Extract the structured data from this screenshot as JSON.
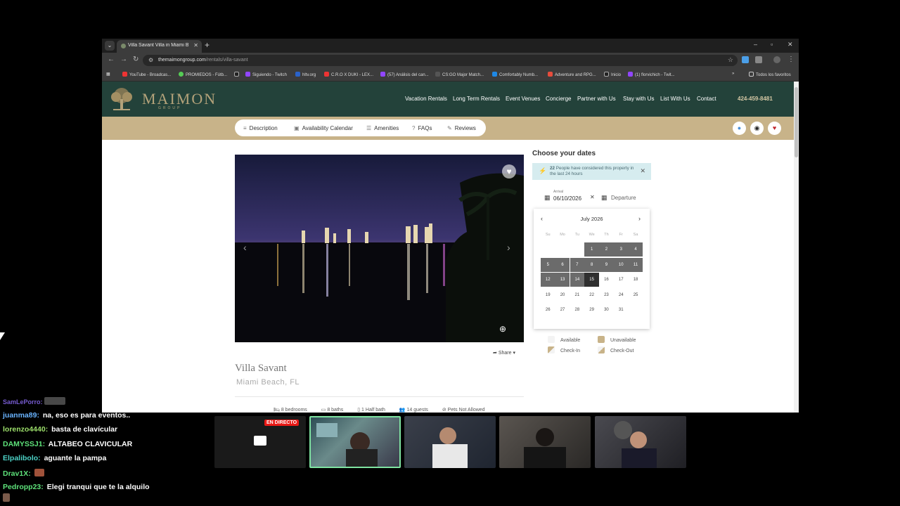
{
  "browser": {
    "tab_title": "Villa Savant Villa in Miami Beach",
    "url_host": "themaimongroup.com",
    "url_path": "/rentals/villa-savant",
    "bookmarks": [
      "YouTube - Broadcas...",
      "PROMIEDOS - Fútb...",
      "Siguiendo - Twitch",
      "hltv.org",
      "C.R.O X DUKI - LEX...",
      "(57) Análisis del can...",
      "CS:GO Major Match...",
      "Comfortably Numb...",
      "Adventure and RPG...",
      "Inicio",
      "(1) florvichich - Twit..."
    ],
    "all_bookmarks": "Todos los favoritos"
  },
  "site": {
    "logo": "MAIMON",
    "logo_sub": "GROUP",
    "nav": [
      "Vacation Rentals",
      "Long Term Rentals",
      "Event Venues",
      "Concierge",
      "Partner with Us",
      "Stay with Us",
      "List With Us",
      "Contact"
    ],
    "phone": "424-459-8481",
    "subnav": [
      "Description",
      "Availability Calendar",
      "Amenities",
      "FAQs",
      "Reviews"
    ]
  },
  "property": {
    "title": "Villa Savant",
    "location": "Miami Beach, FL",
    "share": "Share",
    "facts": [
      "8 bedrooms",
      "8 baths",
      "1 Half bath",
      "14 guests",
      "Pets Not Allowed"
    ]
  },
  "booking": {
    "heading": "Choose your dates",
    "notice_count": "22",
    "notice_text": "People have considered this property in the last 24 hours",
    "arrival_label": "Arrival",
    "arrival_value": "06/10/2026",
    "departure_placeholder": "Departure",
    "month": "July 2026",
    "weekdays": [
      "Su",
      "Mo",
      "Tu",
      "We",
      "Th",
      "Fr",
      "Sa"
    ],
    "legend": {
      "available": "Available",
      "unavailable": "Unavailable",
      "checkin": "Check-In",
      "checkout": "Check-Out"
    },
    "colors": {
      "unavailable": "#6b6b6b",
      "unavailable_swatch": "#c8b389"
    }
  },
  "stream": {
    "live_badge": "EN DIRECTO",
    "chat": [
      {
        "user": "SamLePorro:",
        "color": "#8b6cf5",
        "msg": ""
      },
      {
        "user": "juanma89:",
        "color": "#69b3ff",
        "msg": "na, eso es para eventos.."
      },
      {
        "user": "lorenzo4440:",
        "color": "#9de06b",
        "msg": "basta de clavícular"
      },
      {
        "user": "DAMYSSJ1:",
        "color": "#5ee27a",
        "msg": "ALTABEO CLAVICULAR"
      },
      {
        "user": "Elpalibolo:",
        "color": "#4dd3c7",
        "msg": "aguante la pampa"
      },
      {
        "user": "Drav1X:",
        "color": "#5ee27a",
        "msg": ""
      },
      {
        "user": "Pedropp23:",
        "color": "#5ee27a",
        "msg": "Elegi tranqui que te la alquilo"
      }
    ]
  }
}
